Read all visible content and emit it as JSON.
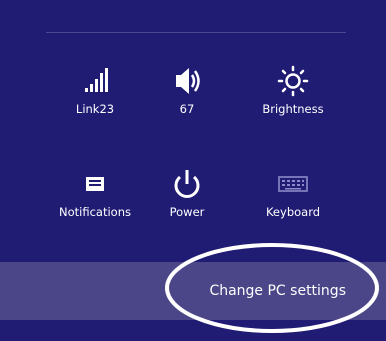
{
  "quick_settings": [
    {
      "label": "Link23",
      "icon": "network-signal-icon"
    },
    {
      "label": "67",
      "icon": "volume-icon"
    },
    {
      "label": "Brightness",
      "icon": "brightness-icon"
    },
    {
      "label": "Notifications",
      "icon": "notifications-icon"
    },
    {
      "label": "Power",
      "icon": "power-icon"
    },
    {
      "label": "Keyboard",
      "icon": "keyboard-icon"
    }
  ],
  "footer": {
    "change_pc_settings_label": "Change PC settings"
  },
  "colors": {
    "panel_bg": "#201c74",
    "footer_bg": "#4b4688",
    "text": "#ffffff",
    "annotation": "#ffffff"
  }
}
